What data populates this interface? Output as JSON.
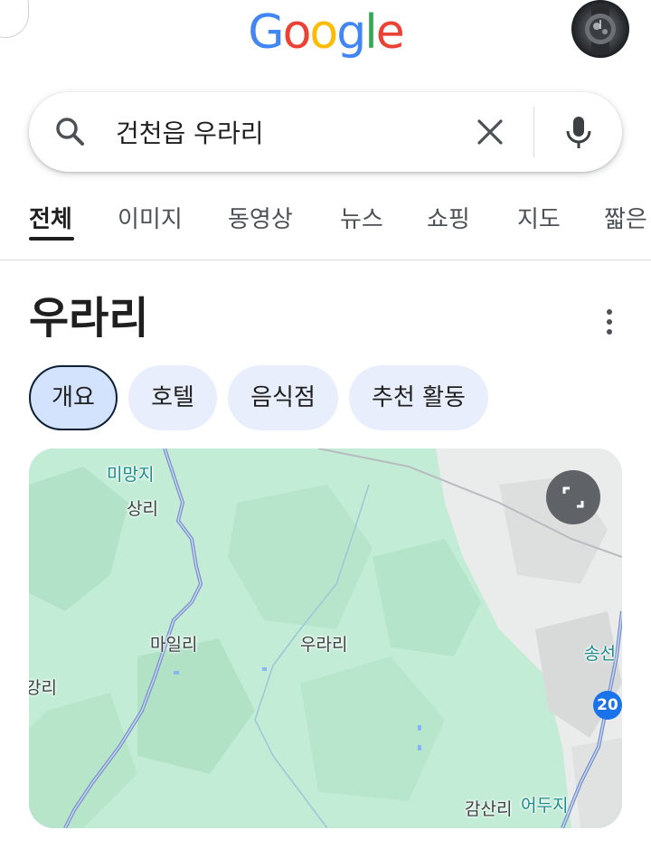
{
  "header": {
    "logo_letters": [
      {
        "char": "G",
        "color": "#4285F4"
      },
      {
        "char": "o",
        "color": "#EA4335"
      },
      {
        "char": "o",
        "color": "#FBBC05"
      },
      {
        "char": "g",
        "color": "#4285F4"
      },
      {
        "char": "l",
        "color": "#34A853"
      },
      {
        "char": "e",
        "color": "#EA4335"
      }
    ],
    "avatar_icon": "profile-avatar"
  },
  "search": {
    "query": "건천읍 우라리",
    "search_icon": "search-icon",
    "clear_icon": "close-icon",
    "voice_icon": "mic-icon"
  },
  "tabs": [
    {
      "label": "전체",
      "active": true
    },
    {
      "label": "이미지",
      "active": false
    },
    {
      "label": "동영상",
      "active": false
    },
    {
      "label": "뉴스",
      "active": false
    },
    {
      "label": "쇼핑",
      "active": false
    },
    {
      "label": "지도",
      "active": false
    },
    {
      "label": "짧은",
      "active": false
    }
  ],
  "knowledge_panel": {
    "title": "우라리",
    "more_icon": "more-vert-icon",
    "chips": [
      {
        "label": "개요",
        "active": true
      },
      {
        "label": "호텔",
        "active": false
      },
      {
        "label": "음식점",
        "active": false
      },
      {
        "label": "추천 활동",
        "active": false
      }
    ]
  },
  "map": {
    "expand_icon": "fullscreen-icon",
    "places": {
      "mimangji": "미망지",
      "sangri": "상리",
      "mailri": "마일리",
      "urari": "우라리",
      "gangri": "강리",
      "songseon": "송선",
      "gamsanri": "감산리",
      "eoduji": "어두지"
    },
    "route_number": "20",
    "colors": {
      "forest": "#c8eddb",
      "river": "#8ab4f8",
      "road": "#7a8fc8",
      "highway": "#1a73e8"
    }
  }
}
